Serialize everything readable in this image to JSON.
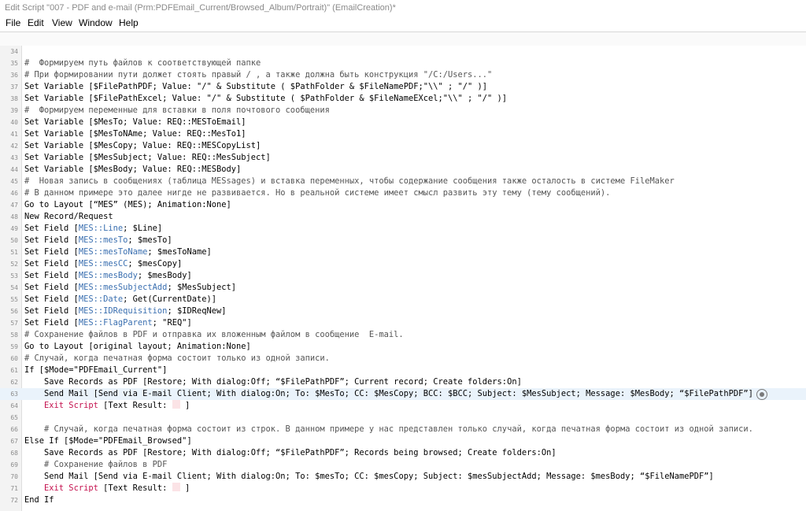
{
  "window": {
    "title": "Edit Script \"007 -  PDF and e-mail (Prm:PDFEmail_Current/Browsed_Album/Portrait)\" (EmailCreation)*"
  },
  "menu": {
    "items": [
      "File",
      "Edit",
      "View",
      "Window",
      "Help"
    ]
  },
  "colors": {
    "comment": "#555555",
    "field_ref": "#3a6fb0",
    "exit_step": "#c4124f",
    "highlight_row": "#eaf3fb"
  },
  "script": {
    "highlighted_line": 63,
    "lines": [
      {
        "num": "34",
        "indent": "",
        "parts": []
      },
      {
        "num": "35",
        "indent": "",
        "parts": [
          {
            "t": "#  Формируем путь файлов к соответствующей папке",
            "c": "c"
          }
        ]
      },
      {
        "num": "36",
        "indent": "",
        "parts": [
          {
            "t": "# При формировании пути должет стоять правый / , а также должна быть конструкция \"/C:/Users...\"",
            "c": "c"
          }
        ]
      },
      {
        "num": "37",
        "indent": "",
        "parts": [
          {
            "t": "Set Variable [$FilePathPDF; Value: \"/\" & Substitute ( $PathFolder & $FileNamePDF;\"\\\\\" ; \"/\" )]",
            "c": "k"
          }
        ]
      },
      {
        "num": "38",
        "indent": "",
        "parts": [
          {
            "t": "Set Variable [$FilePathExcel; Value: \"/\" & Substitute ( $PathFolder & $FileNameEXcel;\"\\\\\" ; \"/\" )]",
            "c": "k"
          }
        ]
      },
      {
        "num": "39",
        "indent": "",
        "parts": [
          {
            "t": "#  Формируем переменные для вставки в поля почтового сообщения",
            "c": "c"
          }
        ]
      },
      {
        "num": "40",
        "indent": "",
        "parts": [
          {
            "t": "Set Variable [$MesTo; Value: REQ::MESToEmail]",
            "c": "k"
          }
        ]
      },
      {
        "num": "41",
        "indent": "",
        "parts": [
          {
            "t": "Set Variable [$MesToNAme; Value: REQ::MesTo1]",
            "c": "k"
          }
        ]
      },
      {
        "num": "42",
        "indent": "",
        "parts": [
          {
            "t": "Set Variable [$MesCopy; Value: REQ::MESCopyList]",
            "c": "k"
          }
        ]
      },
      {
        "num": "43",
        "indent": "",
        "parts": [
          {
            "t": "Set Variable [$MesSubject; Value: REQ::MesSubject]",
            "c": "k"
          }
        ]
      },
      {
        "num": "44",
        "indent": "",
        "parts": [
          {
            "t": "Set Variable [$MesBody; Value: REQ::MESBody]",
            "c": "k"
          }
        ]
      },
      {
        "num": "45",
        "indent": "",
        "parts": [
          {
            "t": "#  Новая запись в сообщениях (таблица MESsages) и вставка переменных, чтобы содержание сообщения также осталость в системе FileMaker",
            "c": "c"
          }
        ]
      },
      {
        "num": "46",
        "indent": "",
        "parts": [
          {
            "t": "# В данном примере это далее нигде не развивается. Но в реальной системе имеет смысл развить эту тему (тему сообщений).",
            "c": "c"
          }
        ]
      },
      {
        "num": "47",
        "indent": "",
        "parts": [
          {
            "t": "Go to Layout [“MES” (MES); Animation:None]",
            "c": "k"
          }
        ]
      },
      {
        "num": "48",
        "indent": "",
        "parts": [
          {
            "t": "New Record/Request",
            "c": "k"
          }
        ]
      },
      {
        "num": "49",
        "indent": "",
        "parts": [
          {
            "t": "Set Field [",
            "c": "k"
          },
          {
            "t": "MES::Line",
            "c": "f"
          },
          {
            "t": "; $Line]",
            "c": "k"
          }
        ]
      },
      {
        "num": "50",
        "indent": "",
        "parts": [
          {
            "t": "Set Field [",
            "c": "k"
          },
          {
            "t": "MES::mesTo",
            "c": "f"
          },
          {
            "t": "; $mesTo]",
            "c": "k"
          }
        ]
      },
      {
        "num": "51",
        "indent": "",
        "parts": [
          {
            "t": "Set Field [",
            "c": "k"
          },
          {
            "t": "MES::mesToName",
            "c": "f"
          },
          {
            "t": "; $mesToName]",
            "c": "k"
          }
        ]
      },
      {
        "num": "52",
        "indent": "",
        "parts": [
          {
            "t": "Set Field [",
            "c": "k"
          },
          {
            "t": "MES::mesCC",
            "c": "f"
          },
          {
            "t": "; $mesCopy]",
            "c": "k"
          }
        ]
      },
      {
        "num": "53",
        "indent": "",
        "parts": [
          {
            "t": "Set Field [",
            "c": "k"
          },
          {
            "t": "MES::mesBody",
            "c": "f"
          },
          {
            "t": "; $mesBody]",
            "c": "k"
          }
        ]
      },
      {
        "num": "54",
        "indent": "",
        "parts": [
          {
            "t": "Set Field [",
            "c": "k"
          },
          {
            "t": "MES::mesSubjectAdd",
            "c": "f"
          },
          {
            "t": "; $MesSubject]",
            "c": "k"
          }
        ]
      },
      {
        "num": "55",
        "indent": "",
        "parts": [
          {
            "t": "Set Field [",
            "c": "k"
          },
          {
            "t": "MES::Date",
            "c": "f"
          },
          {
            "t": "; Get(CurrentDate)]",
            "c": "k"
          }
        ]
      },
      {
        "num": "56",
        "indent": "",
        "parts": [
          {
            "t": "Set Field [",
            "c": "k"
          },
          {
            "t": "MES::IDRequisition",
            "c": "f"
          },
          {
            "t": "; $IDReqNew]",
            "c": "k"
          }
        ]
      },
      {
        "num": "57",
        "indent": "",
        "parts": [
          {
            "t": "Set Field [",
            "c": "k"
          },
          {
            "t": "MES::FlagParent",
            "c": "f"
          },
          {
            "t": "; \"REQ\"]",
            "c": "k"
          }
        ]
      },
      {
        "num": "58",
        "indent": "",
        "parts": [
          {
            "t": "# Сохранение файлов в PDF и отправка их вложенным файлом в сообщение  E-mail.",
            "c": "c"
          }
        ]
      },
      {
        "num": "59",
        "indent": "",
        "parts": [
          {
            "t": "Go to Layout [original layout; Animation:None]",
            "c": "k"
          }
        ]
      },
      {
        "num": "60",
        "indent": "",
        "parts": [
          {
            "t": "# Случай, когда печатная форма состоит только из одной записи.",
            "c": "c"
          }
        ]
      },
      {
        "num": "61",
        "indent": "",
        "parts": [
          {
            "t": "If [$Mode=\"PDFEmail_Current\"]",
            "c": "k"
          }
        ]
      },
      {
        "num": "62",
        "indent": "    ",
        "parts": [
          {
            "t": "Save Records as PDF [Restore; With dialog:Off; “$FilePathPDF”; Current record; Create folders:On]",
            "c": "k"
          }
        ]
      },
      {
        "num": "63",
        "indent": "    ",
        "parts": [
          {
            "t": "Send Mail [Send via E-mail Client; With dialog:On; To: $MesTo; CC: $MesCopy; BCC: $BCC; Subject: $MesSubject; Message: $MesBody; “$FilePathPDF”]",
            "c": "k"
          }
        ]
      },
      {
        "num": "64",
        "indent": "    ",
        "parts": [
          {
            "t": "Exit Script ",
            "c": "e"
          },
          {
            "t": "[Text Result: ",
            "c": "k"
          },
          {
            "t": "BOX",
            "c": "box"
          },
          {
            "t": " ]",
            "c": "k"
          }
        ]
      },
      {
        "num": "65",
        "indent": "",
        "parts": []
      },
      {
        "num": "66",
        "indent": "    ",
        "parts": [
          {
            "t": "# Случай, когда печатная форма состоит из строк. В данном примере у нас представлен только случай, когда печатная форма состоит из одной записи.",
            "c": "c"
          }
        ]
      },
      {
        "num": "67",
        "indent": "",
        "parts": [
          {
            "t": "Else If [$Mode=\"PDFEmail_Browsed\"]",
            "c": "k"
          }
        ]
      },
      {
        "num": "68",
        "indent": "    ",
        "parts": [
          {
            "t": "Save Records as PDF [Restore; With dialog:Off; “$FilePathPDF”; Records being browsed; Create folders:On]",
            "c": "k"
          }
        ]
      },
      {
        "num": "69",
        "indent": "    ",
        "parts": [
          {
            "t": "# Сохранение файлов в PDF",
            "c": "c"
          }
        ]
      },
      {
        "num": "70",
        "indent": "    ",
        "parts": [
          {
            "t": "Send Mail [Send via E-mail Client; With dialog:On; To: $mesTo; CC: $mesCopy; Subject: $mesSubjectAdd; Message: $mesBody; “$FileNamePDF”]",
            "c": "k"
          }
        ]
      },
      {
        "num": "71",
        "indent": "    ",
        "parts": [
          {
            "t": "Exit Script ",
            "c": "e"
          },
          {
            "t": "[Text Result: ",
            "c": "k"
          },
          {
            "t": "BOX",
            "c": "box"
          },
          {
            "t": " ]",
            "c": "k"
          }
        ]
      },
      {
        "num": "72",
        "indent": "",
        "parts": [
          {
            "t": "End If",
            "c": "k"
          }
        ]
      }
    ]
  },
  "icons": {
    "step_options": "gear-icon"
  }
}
